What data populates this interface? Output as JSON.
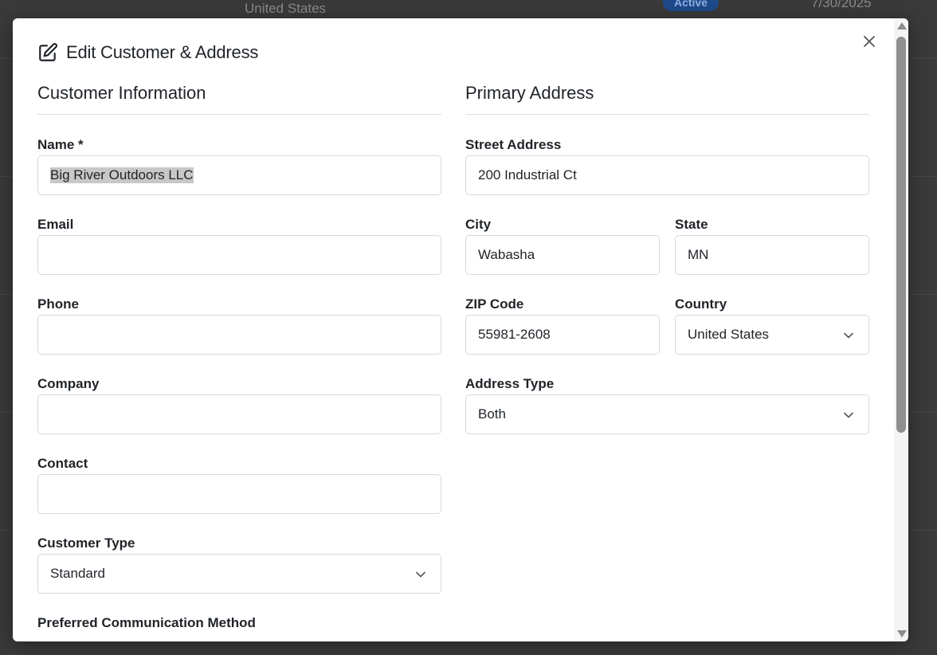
{
  "background": {
    "country_text": "United States",
    "status_badge": "Active",
    "date_text": "7/30/2025"
  },
  "modal": {
    "title": "Edit Customer & Address",
    "title_icon": "edit-icon",
    "close_icon": "close-icon"
  },
  "customer": {
    "section_title": "Customer Information",
    "name_label": "Name *",
    "name_value": "Big River Outdoors LLC",
    "email_label": "Email",
    "email_value": "",
    "phone_label": "Phone",
    "phone_value": "",
    "company_label": "Company",
    "company_value": "",
    "contact_label": "Contact",
    "contact_value": "",
    "customer_type_label": "Customer Type",
    "customer_type_value": "Standard",
    "preferred_comm_label": "Preferred Communication Method"
  },
  "address": {
    "section_title": "Primary Address",
    "street_label": "Street Address",
    "street_value": "200 Industrial Ct",
    "city_label": "City",
    "city_value": "Wabasha",
    "state_label": "State",
    "state_value": "MN",
    "zip_label": "ZIP Code",
    "zip_value": "55981-2608",
    "country_label": "Country",
    "country_value": "United States",
    "address_type_label": "Address Type",
    "address_type_value": "Both"
  }
}
